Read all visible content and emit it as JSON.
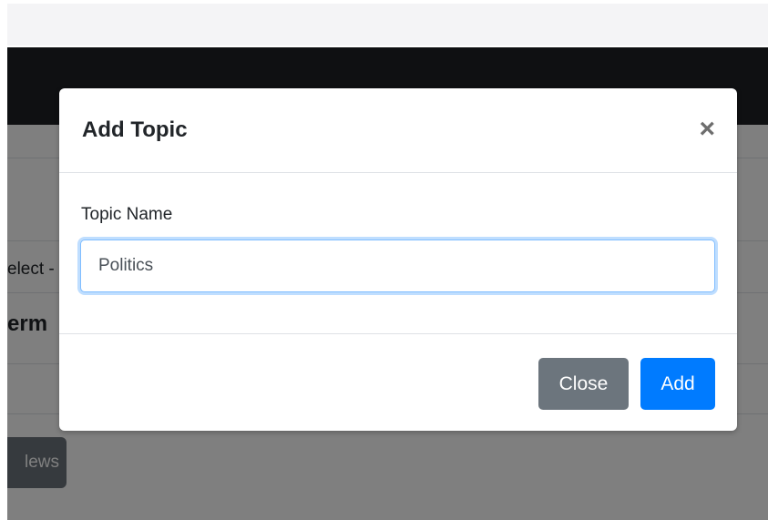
{
  "background": {
    "select_partial_text": "elect -",
    "term_partial_text": "erm",
    "news_button_partial_label": "lews"
  },
  "modal": {
    "title": "Add Topic",
    "close_icon_glyph": "×",
    "field_label": "Topic Name",
    "topic_input_value": "Politics",
    "close_button_label": "Close",
    "add_button_label": "Add"
  },
  "colors": {
    "navbar": "#1f2024",
    "primary": "#007bff",
    "secondary": "#6c757d",
    "input_focus_border": "#80bdff"
  }
}
